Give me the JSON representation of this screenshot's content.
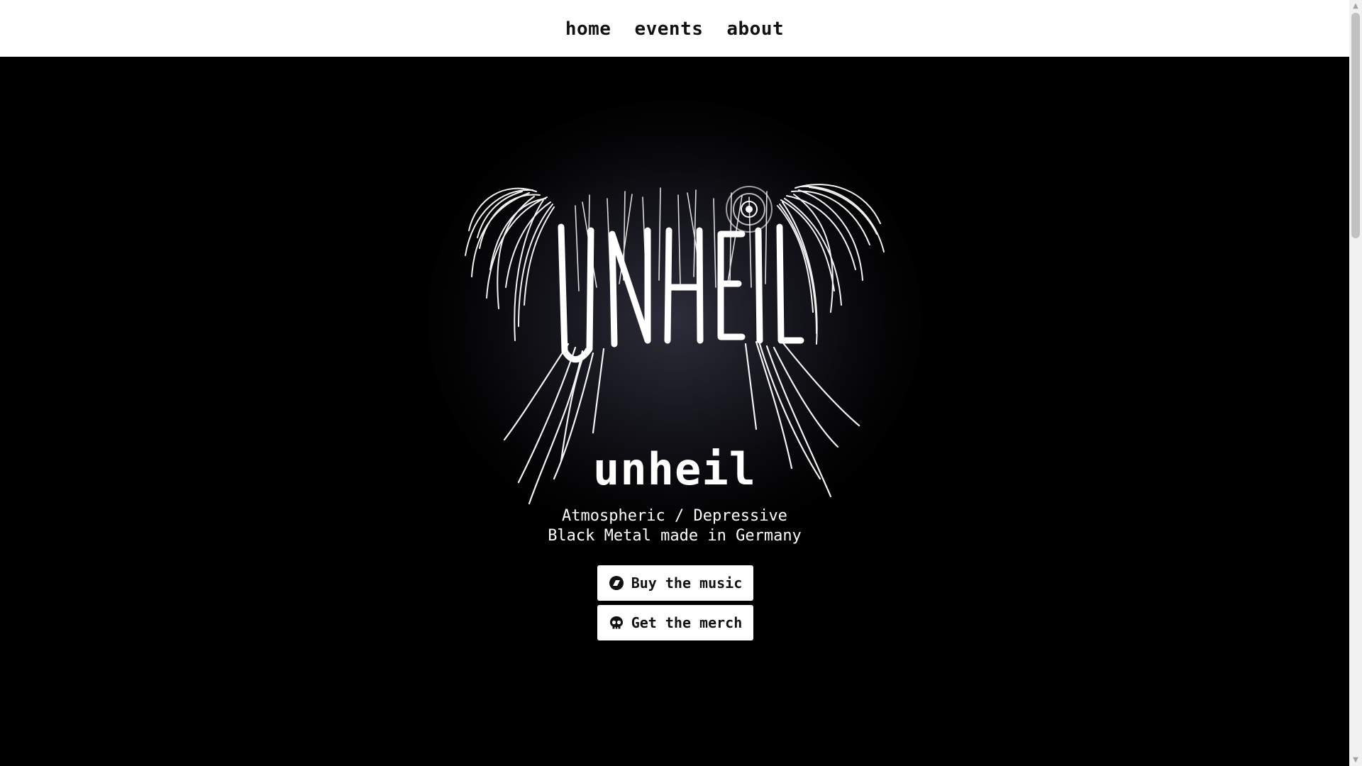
{
  "nav": {
    "items": [
      {
        "label": "home"
      },
      {
        "label": "events"
      },
      {
        "label": "about"
      }
    ]
  },
  "hero": {
    "logo": {
      "text": "UNHEIL",
      "icon": "band-logo-icon"
    },
    "band_name": "unheil",
    "tagline_line1": "Atmospheric / Depressive",
    "tagline_line2": "Black Metal made in Germany"
  },
  "buttons": {
    "music": {
      "label": "Buy the music",
      "icon": "bandcamp-icon"
    },
    "merch": {
      "label": "Get the merch",
      "icon": "skull-icon"
    }
  },
  "colors": {
    "nav_bg": "#ffffff",
    "hero_bg": "#000000",
    "text_light": "#ffffff",
    "text_dark": "#111111"
  }
}
